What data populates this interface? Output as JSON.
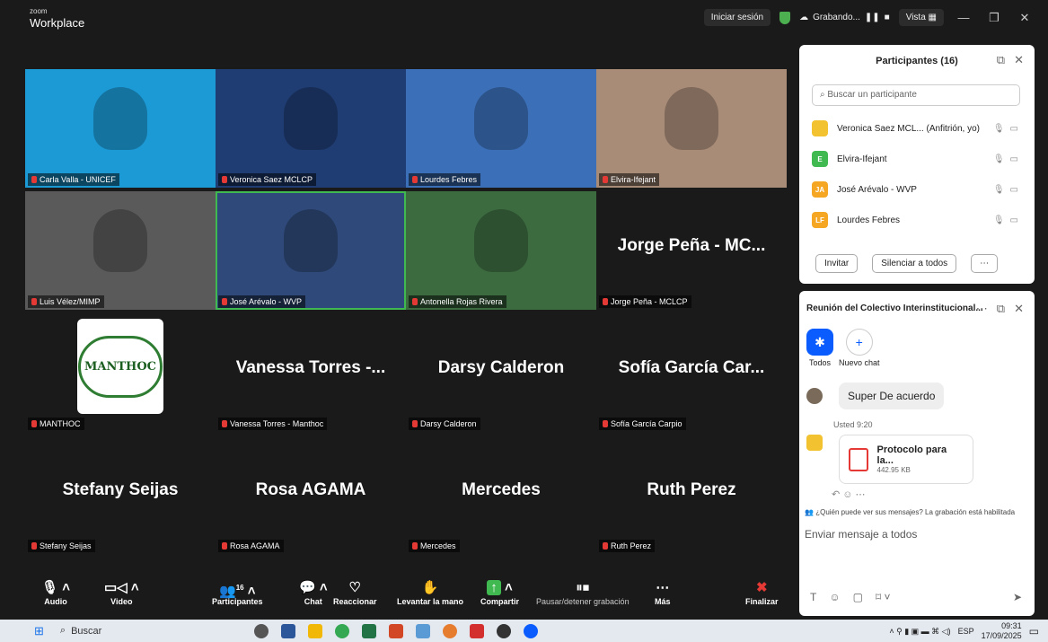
{
  "app": {
    "brand_small": "zoom",
    "brand": "Workplace",
    "signin": "Iniciar sesión",
    "recording": "Grabando...",
    "view": "Vista"
  },
  "tiles": [
    {
      "name": "Carla Valla - UNICEF",
      "bg": "#1c9ad6"
    },
    {
      "name": "Veronica Saez MCLCP",
      "bg": "#1f3d73"
    },
    {
      "name": "Lourdes Febres",
      "bg": "#3b6fb8"
    },
    {
      "name": "Elvira-Ifejant",
      "bg": "#a88c78"
    },
    {
      "name": "Luis Vélez/MIMP",
      "bg": "#5a5a5a"
    },
    {
      "name": "José Arévalo - WVP",
      "bg": "#2f4a7a"
    },
    {
      "name": "Antonella Rojas Rivera",
      "bg": "#3d6b40"
    },
    {
      "name": "Jorge Peña - MCLCP",
      "big": "Jorge Peña - MC..."
    },
    {
      "name": "MANTHOC",
      "logo": "MANTHOC"
    },
    {
      "name": "Vanessa Torres - Manthoc",
      "big": "Vanessa Torres -..."
    },
    {
      "name": "Darsy Calderon",
      "big": "Darsy Calderon"
    },
    {
      "name": "Sofía García Carpio",
      "big": "Sofía García Car..."
    },
    {
      "name": "Stefany Seijas",
      "big": "Stefany Seijas"
    },
    {
      "name": "Rosa AGAMA",
      "big": "Rosa AGAMA"
    },
    {
      "name": "Mercedes",
      "big": "Mercedes"
    },
    {
      "name": "Ruth Perez",
      "big": "Ruth Perez"
    }
  ],
  "toolbar": {
    "audio": "Audio",
    "video": "Video",
    "participants": "Participantes",
    "participants_count": "16",
    "chat": "Chat",
    "react": "Reaccionar",
    "raise": "Levantar la mano",
    "share": "Compartir",
    "pause": "Pausar/detener grabación",
    "more": "Más",
    "end": "Finalizar"
  },
  "participants_panel": {
    "title": "Participantes (16)",
    "search_placeholder": "Buscar un participante",
    "invite": "Invitar",
    "mute_all": "Silenciar a todos",
    "list": [
      {
        "name": "Veronica Saez MCL... (Anfitrión, yo)",
        "initials": "",
        "color": "#f2c230"
      },
      {
        "name": "Elvira-Ifejant",
        "initials": "E",
        "color": "#3fb950"
      },
      {
        "name": "José Arévalo - WVP",
        "initials": "JA",
        "color": "#f5a623"
      },
      {
        "name": "Lourdes Febres",
        "initials": "LF",
        "color": "#f5a623"
      }
    ]
  },
  "chat": {
    "title": "Reunión del Colectivo Interinstitucional...",
    "tab_all": "Todos",
    "tab_new": "Nuevo chat",
    "msg1": "Super De acuerdo",
    "time2": "Usted 9:20",
    "file_name": "Protocolo para la...",
    "file_size": "442.95 KB",
    "notice": "¿Quién puede ver sus mensajes? La grabación está habilitada",
    "input_placeholder": "Enviar mensaje a todos"
  },
  "taskbar": {
    "search": "Buscar",
    "lang": "ESP",
    "time": "09:31",
    "date": "17/09/2025"
  }
}
